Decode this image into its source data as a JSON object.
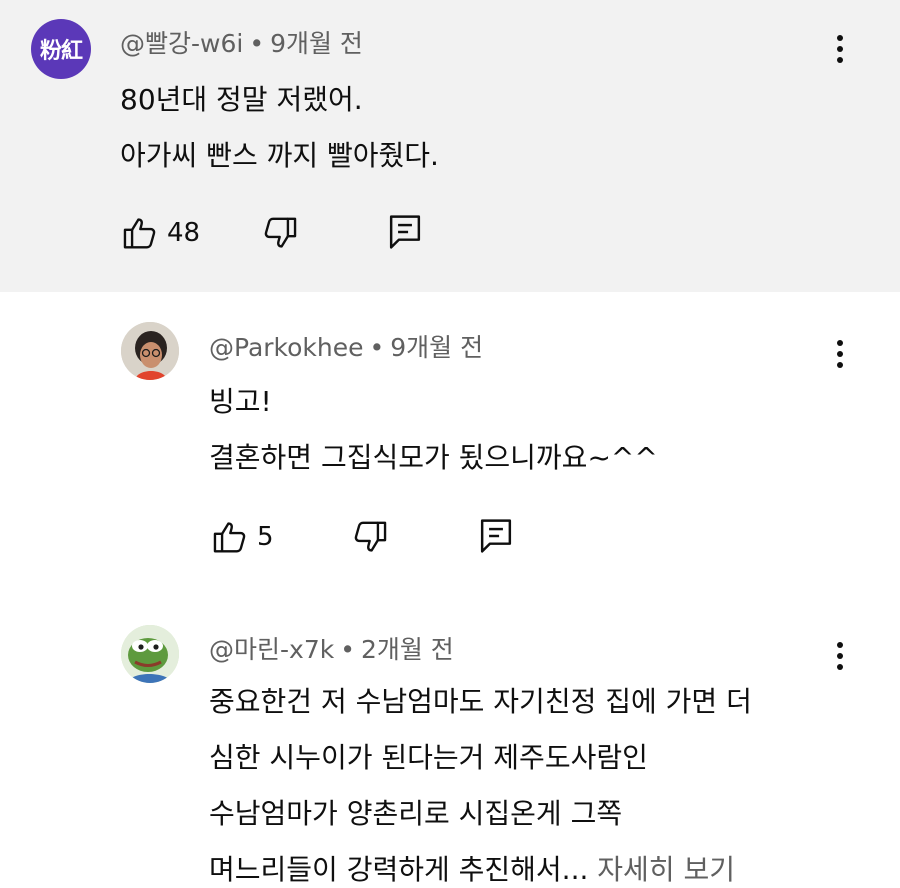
{
  "comments": [
    {
      "avatar_text": "粉紅",
      "author": "@빨강-w6i",
      "time": "9개월 전",
      "lines": [
        "80년대 정말 저랬어.",
        "아가씨 빤스 까지 빨아줬다."
      ],
      "likes": "48"
    },
    {
      "author": "@Parkokhee",
      "time": "9개월 전",
      "lines": [
        "빙고!",
        "결혼하면 그집식모가 됬으니까요~^^"
      ],
      "likes": "5"
    },
    {
      "author": "@마린-x7k",
      "time": "2개월 전",
      "lines": [
        "중요한건 저 수남엄마도 자기친정 집에 가면 더",
        "심한 시누이가 된다는거 제주도사람인",
        "수남엄마가 양촌리로 시집온게 그쪽",
        "며느리들이 강력하게 추진해서..."
      ],
      "more_label": "자세히 보기"
    }
  ],
  "separator": "•",
  "icons": {
    "like": "thumbs-up-icon",
    "dislike": "thumbs-down-icon",
    "reply": "reply-icon",
    "menu": "more-vertical-icon"
  },
  "colors": {
    "highlight_bg": "#f2f2f2",
    "secondary_text": "#606060",
    "avatar_purple": "#5b38b8"
  }
}
